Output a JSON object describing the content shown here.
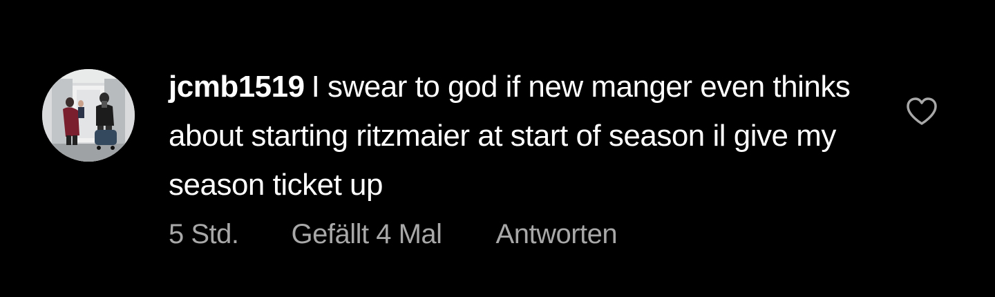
{
  "comment": {
    "username": "jcmb1519",
    "text": "I swear to god if new manger even thinks about starting ritzmaier at start of season il give my season ticket up",
    "time": "5 Std.",
    "likes": "Gefällt 4 Mal",
    "reply_label": "Antworten",
    "like_icon": "heart-outline-icon",
    "avatar_icon": "profile-photo"
  },
  "colors": {
    "background": "#000000",
    "text": "#ffffff",
    "meta_text": "#a8a8a8",
    "icon": "#a8a8a8"
  }
}
